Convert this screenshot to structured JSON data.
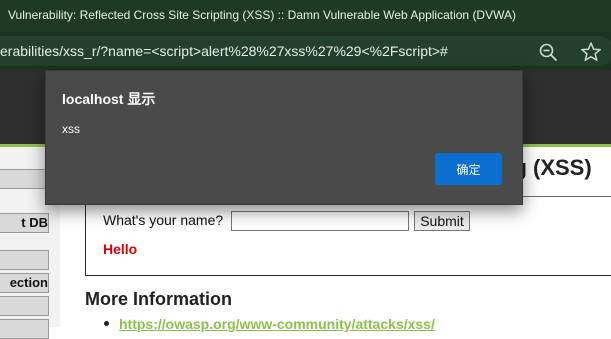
{
  "browser": {
    "tab_title": "Vulnerability: Reflected Cross Site Scripting (XSS) :: Damn Vulnerable Web Application (DVWA)",
    "url": "erabilities/xss_r/?name=<script>alert%28%27xss%27%29<%2Fscript>#"
  },
  "sidebar": {
    "items": [
      "",
      "t DB",
      "",
      "ection",
      "",
      ""
    ]
  },
  "page": {
    "heading_partial": "ng (XSS)",
    "form": {
      "name_label": "What's your name?",
      "name_value": "",
      "submit_label": "Submit"
    },
    "output_text": "Hello",
    "more_info_heading": "More Information",
    "more_info_link": "https://owasp.org/www-community/attacks/xss/"
  },
  "dialog": {
    "title": "localhost 显示",
    "message": "xss",
    "ok_label": "确定"
  },
  "colors": {
    "accent_green": "#8bc34a",
    "dialog_button_blue": "#0b6fcf",
    "hello_red": "#e00000"
  }
}
